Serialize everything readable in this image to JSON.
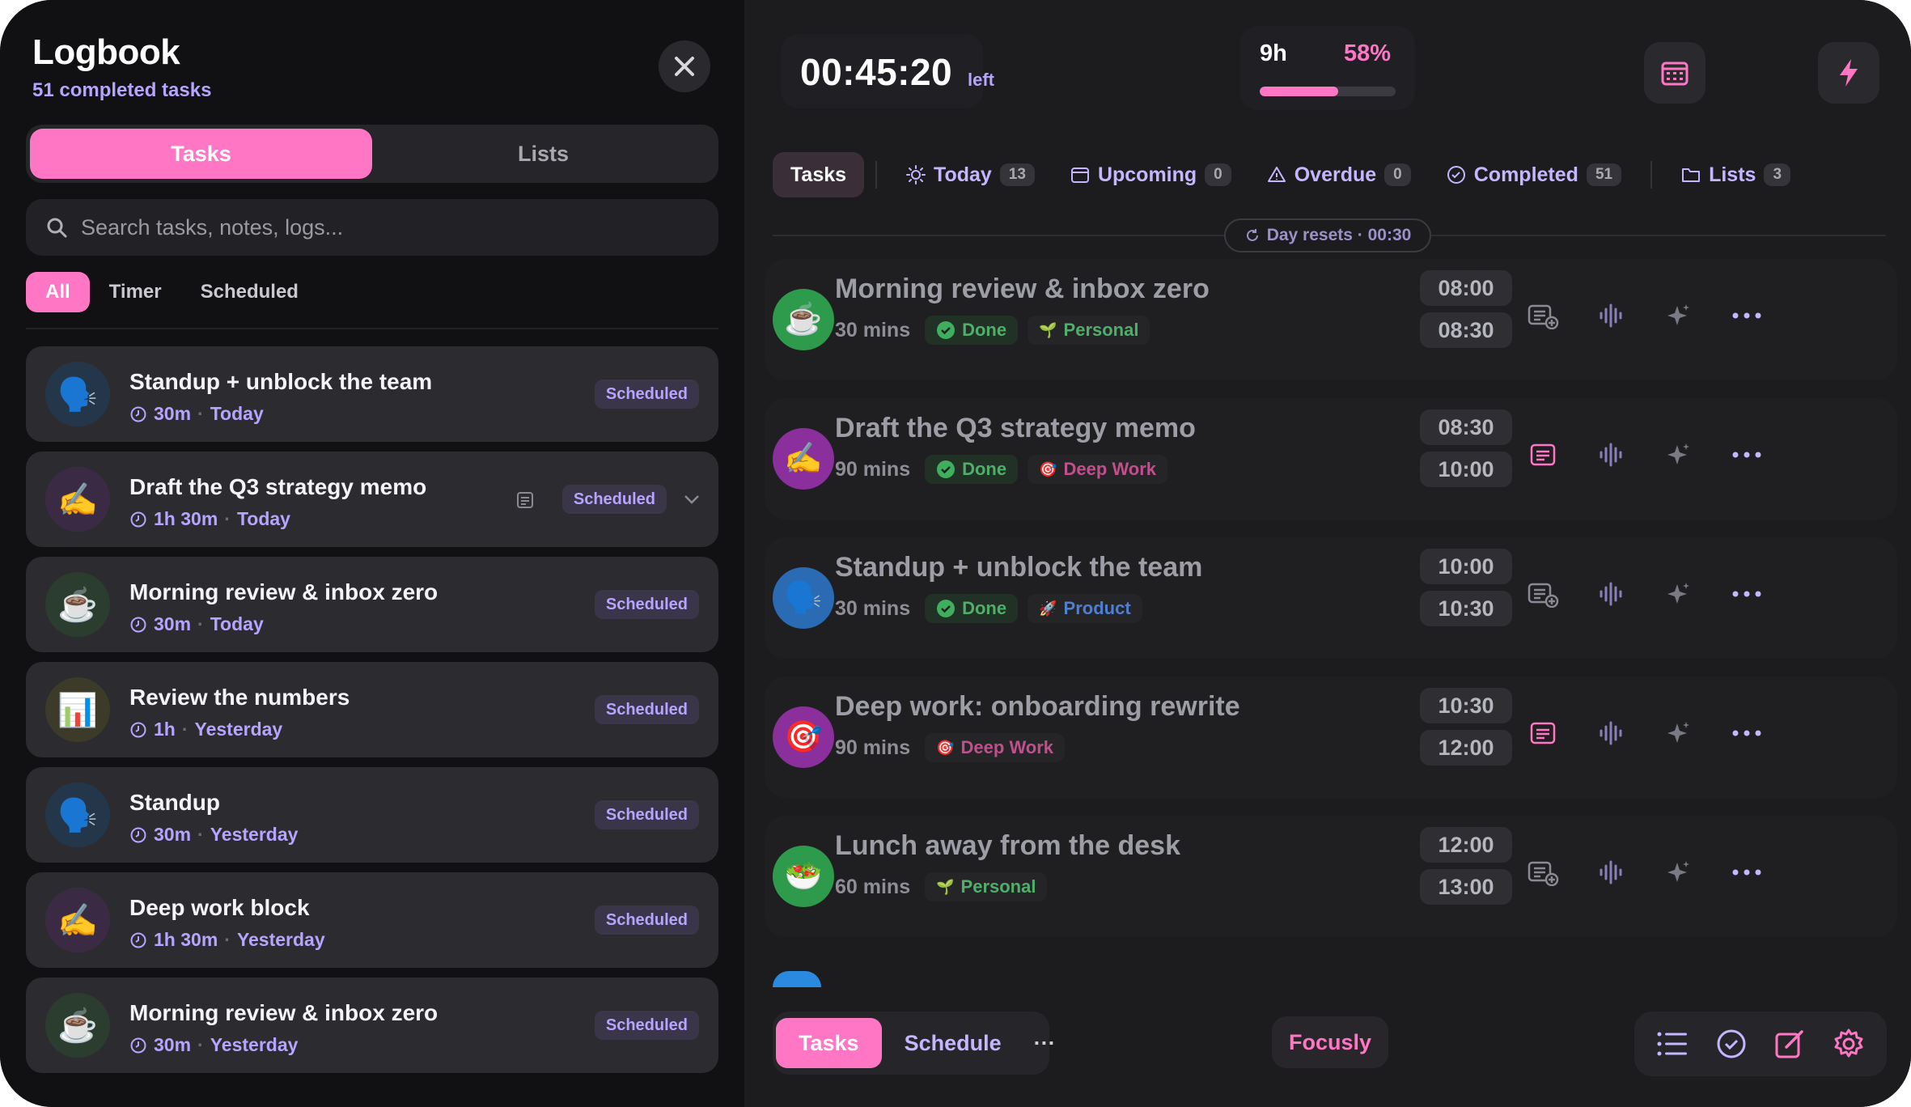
{
  "logbook": {
    "title": "Logbook",
    "subtitle": "51 completed tasks",
    "segments": [
      "Tasks",
      "Lists"
    ],
    "search_placeholder": "Search tasks, notes, logs...",
    "filters": [
      "All",
      "Timer",
      "Scheduled"
    ],
    "items": [
      {
        "emoji": "🗣️",
        "name": "Standup + unblock the team",
        "duration": "30m",
        "day": "Today",
        "badge": "Scheduled",
        "avatar_color": "#24374a"
      },
      {
        "emoji": "✍️",
        "name": "Draft the Q3 strategy memo",
        "duration": "1h 30m",
        "day": "Today",
        "badge": "Scheduled",
        "avatar_color": "#3b2a44"
      },
      {
        "emoji": "☕",
        "name": "Morning review & inbox zero",
        "duration": "30m",
        "day": "Today",
        "badge": "Scheduled",
        "avatar_color": "#2a3d2e"
      },
      {
        "emoji": "📊",
        "name": "Review the numbers",
        "duration": "1h",
        "day": "Yesterday",
        "badge": "Scheduled",
        "avatar_color": "#3c3a28"
      },
      {
        "emoji": "🗣️",
        "name": "Standup",
        "duration": "30m",
        "day": "Yesterday",
        "badge": "Scheduled",
        "avatar_color": "#24374a"
      },
      {
        "emoji": "✍️",
        "name": "Deep work block",
        "duration": "1h 30m",
        "day": "Yesterday",
        "badge": "Scheduled",
        "avatar_color": "#3b2a44"
      },
      {
        "emoji": "☕",
        "name": "Morning review & inbox zero",
        "duration": "30m",
        "day": "Yesterday",
        "badge": "Scheduled",
        "avatar_color": "#2a3d2e"
      }
    ]
  },
  "timer": {
    "value": "00:45:20",
    "suffix": "left"
  },
  "progress": {
    "hours": "9h",
    "percent_label": "58%",
    "fraction": 0.58
  },
  "tabs": [
    {
      "label": "Tasks",
      "count": ""
    },
    {
      "label": "Today",
      "count": "13"
    },
    {
      "label": "Upcoming",
      "count": "0"
    },
    {
      "label": "Overdue",
      "count": "0"
    },
    {
      "label": "Completed",
      "count": "51"
    },
    {
      "label": "Lists",
      "count": "3"
    }
  ],
  "reset_label": "Day resets · 00:30",
  "tasks": [
    {
      "emoji": "☕",
      "name": "Morning review & inbox zero",
      "mins": "30 mins",
      "done": "Done",
      "tag": "Personal",
      "tag_emoji": "🌱",
      "start": "08:00",
      "end": "08:30",
      "avatar_color": "#2e9a4c"
    },
    {
      "emoji": "✍️",
      "name": "Draft the Q3 strategy memo",
      "mins": "90 mins",
      "done": "Done",
      "tag": "Deep Work",
      "tag_emoji": "🎯",
      "start": "08:30",
      "end": "10:00",
      "avatar_color": "#8a2f9c"
    },
    {
      "emoji": "🗣️",
      "name": "Standup + unblock the team",
      "mins": "30 mins",
      "done": "Done",
      "tag": "Product",
      "tag_emoji": "🚀",
      "start": "10:00",
      "end": "10:30",
      "avatar_color": "#2a6bb4"
    },
    {
      "emoji": "🎯",
      "name": "Deep work: onboarding rewrite",
      "mins": "90 mins",
      "done": "",
      "tag": "Deep Work",
      "tag_emoji": "🎯",
      "start": "10:30",
      "end": "12:00",
      "avatar_color": "#8a2f9c"
    },
    {
      "emoji": "🥗",
      "name": "Lunch away from the desk",
      "mins": "60 mins",
      "done": "",
      "tag": "Personal",
      "tag_emoji": "🌱",
      "start": "12:00",
      "end": "13:00",
      "avatar_color": "#2e9a4c"
    }
  ],
  "bottom": {
    "tabs": [
      "Tasks",
      "Schedule"
    ],
    "more": "···",
    "brand": "Focusly"
  },
  "colors": {
    "accent": "#ff76c4",
    "lavender": "#b7a4ff",
    "done_green": "#4fae6a"
  }
}
